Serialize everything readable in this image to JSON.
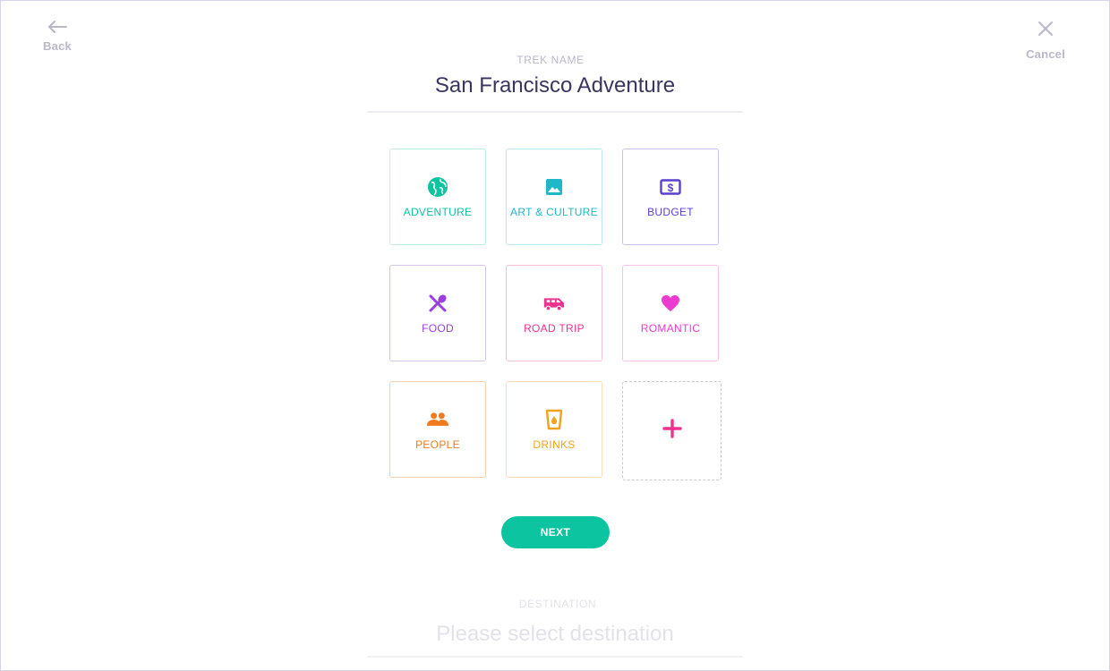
{
  "nav": {
    "back_label": "Back",
    "cancel_label": "Cancel"
  },
  "trek": {
    "label": "TREK NAME",
    "name": "San Francisco Adventure"
  },
  "categories": [
    {
      "label": "ADVENTURE",
      "icon": "globe-icon",
      "color": "#0cc4a0",
      "border": "#bfeee5"
    },
    {
      "label": "ART & CULTURE",
      "icon": "image-icon",
      "color": "#1fb8c9",
      "border": "#b6e9ee"
    },
    {
      "label": "BUDGET",
      "icon": "money-icon",
      "color": "#5b3fd3",
      "border": "#c9c3ea"
    },
    {
      "label": "FOOD",
      "icon": "utensils-icon",
      "color": "#9b3fe0",
      "border": "#d5c5ec"
    },
    {
      "label": "ROAD TRIP",
      "icon": "van-icon",
      "color": "#f0318f",
      "border": "#f7bfd9"
    },
    {
      "label": "ROMANTIC",
      "icon": "heart-icon",
      "color": "#ec3bd1",
      "border": "#f5c2ec"
    },
    {
      "label": "PEOPLE",
      "icon": "people-icon",
      "color": "#f07a1e",
      "border": "#f8cdaa"
    },
    {
      "label": "DRINKS",
      "icon": "drink-icon",
      "color": "#f2a21b",
      "border": "#f9dfb2"
    }
  ],
  "add": {
    "icon": "plus-icon",
    "color": "#f0318f"
  },
  "next_label": "NEXT",
  "destination": {
    "label": "DESTINATION",
    "placeholder": "Please select destination"
  }
}
